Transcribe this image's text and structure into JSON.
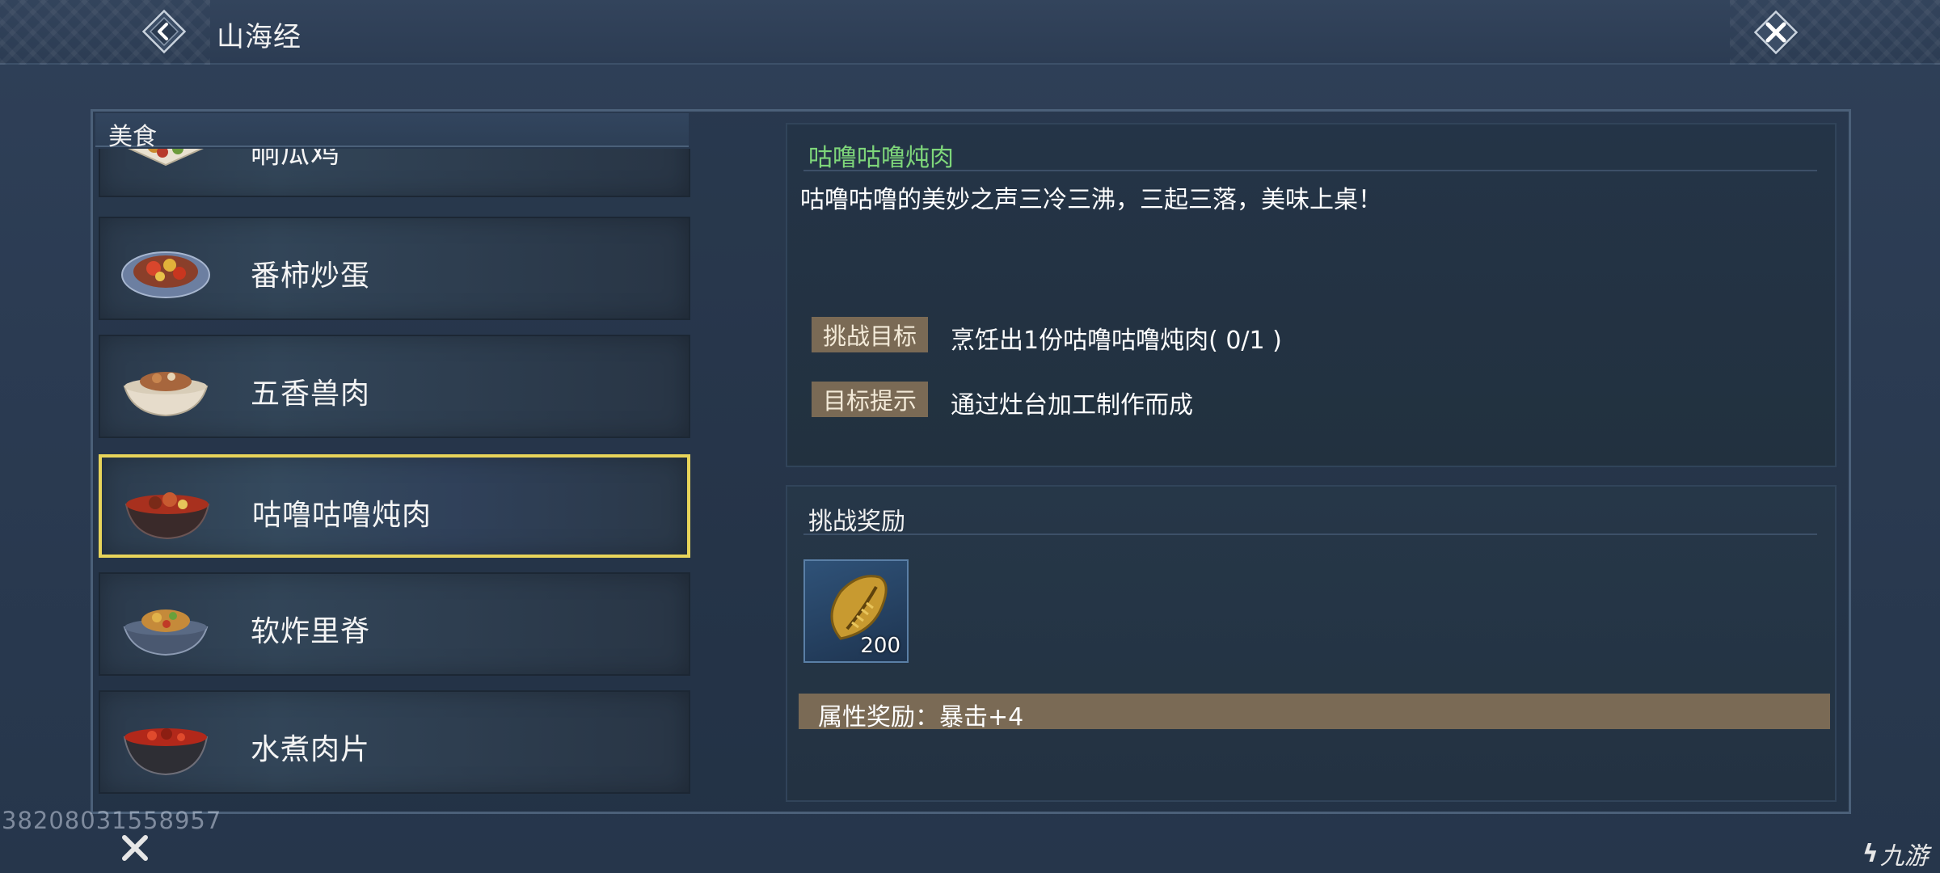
{
  "header": {
    "title": "山海经"
  },
  "list": {
    "section_label": "美食",
    "items": [
      {
        "name": "晌瓜鸡",
        "icon": "dish-plate-icon"
      },
      {
        "name": "番柿炒蛋",
        "icon": "dish-plate-icon"
      },
      {
        "name": "五香兽肉",
        "icon": "dish-bowl-icon"
      },
      {
        "name": "咕噜咕噜炖肉",
        "icon": "dish-bowl-icon"
      },
      {
        "name": "软炸里脊",
        "icon": "dish-bowl-icon"
      },
      {
        "name": "水煮肉片",
        "icon": "dish-bowl-icon"
      }
    ]
  },
  "detail": {
    "title": "咕噜咕噜炖肉",
    "description": "咕噜咕噜的美妙之声三冷三沸，三起三落，美味上桌！",
    "goal_label": "挑战目标",
    "goal_text": "烹饪出1份咕噜咕噜炖肉( 0/1 )",
    "hint_label": "目标提示",
    "hint_text": "通过灶台加工制作而成"
  },
  "reward": {
    "title": "挑战奖励",
    "item_icon": "gold-seed-icon",
    "item_count": "200",
    "attribute_text": "属性奖励：暴击+4"
  },
  "footer": {
    "id_text": "38208031558957",
    "logo_text": "九游"
  },
  "colors": {
    "selected_border": "#e8d45a",
    "detail_title": "#7ed67a",
    "tag_bg": "#7a6a55"
  }
}
